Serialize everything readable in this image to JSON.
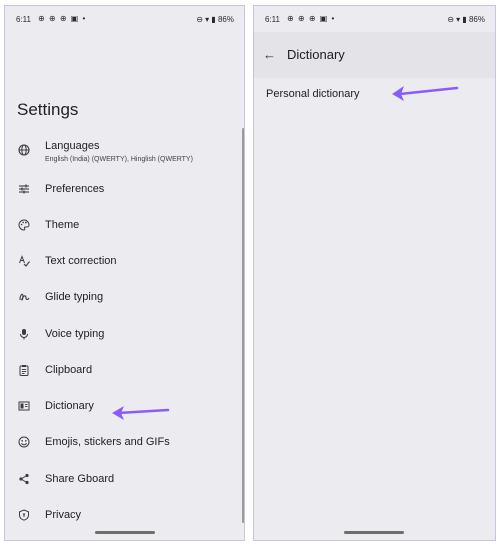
{
  "left": {
    "status": {
      "time": "6:11",
      "notifs": "⊕ ⊕ ⊕ ▣ •",
      "system": "⊖ ▾ ▮ 86%"
    },
    "title": "Settings",
    "items": [
      {
        "label": "Languages",
        "sublabel": "English (India) (QWERTY), Hinglish (QWERTY)",
        "icon": "globe-icon"
      },
      {
        "label": "Preferences",
        "icon": "sliders-icon"
      },
      {
        "label": "Theme",
        "icon": "palette-icon"
      },
      {
        "label": "Text correction",
        "icon": "spellcheck-icon"
      },
      {
        "label": "Glide typing",
        "icon": "glide-icon"
      },
      {
        "label": "Voice typing",
        "icon": "microphone-icon"
      },
      {
        "label": "Clipboard",
        "icon": "clipboard-icon"
      },
      {
        "label": "Dictionary",
        "icon": "dictionary-icon"
      },
      {
        "label": "Emojis, stickers and GIFs",
        "icon": "emoji-icon"
      },
      {
        "label": "Share Gboard",
        "icon": "share-icon"
      },
      {
        "label": "Privacy",
        "icon": "shield-icon"
      }
    ]
  },
  "right": {
    "status": {
      "time": "6:11",
      "notifs": "⊕ ⊕ ⊕ ▣ •",
      "system": "⊖ ▾ ▮ 86%"
    },
    "title": "Dictionary",
    "items": [
      {
        "label": "Personal dictionary"
      }
    ]
  },
  "colors": {
    "arrow": "#8b5cf6",
    "screen_bg": "#ebebf0",
    "frame_border": "#c9c2e3"
  }
}
